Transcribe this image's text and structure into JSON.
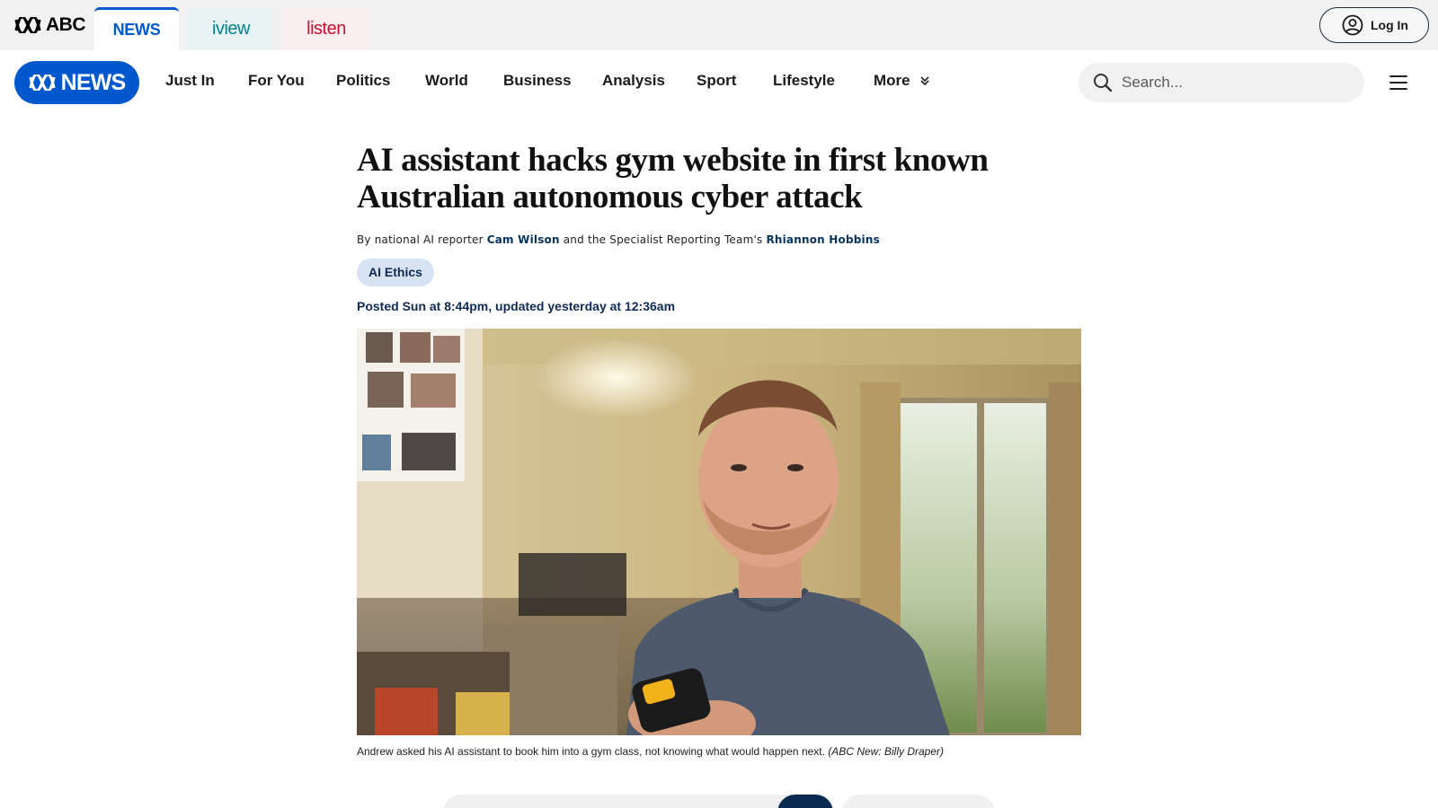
{
  "network": {
    "abc_logo_text": "ABC",
    "tabs": [
      {
        "label": "NEWS",
        "active": true
      },
      {
        "label": "iview"
      },
      {
        "label": "listen"
      }
    ],
    "login_label": "Log In"
  },
  "nav": {
    "brand_label": "NEWS",
    "items": [
      "Just In",
      "For You",
      "Politics",
      "World",
      "Business",
      "Analysis",
      "Sport",
      "Lifestyle",
      "More"
    ],
    "search_placeholder": "Search..."
  },
  "article": {
    "headline": "AI assistant hacks gym website in first known Australian autonomous cyber attack",
    "byline": {
      "prefix": "By national AI reporter",
      "author1": "Cam Wilson",
      "middle": "and the Specialist Reporting Team's",
      "author2": "Rhiannon Hobbins"
    },
    "tag": "AI Ethics",
    "timestamp": "Posted Sun at 8:44pm, updated yesterday at  12:36am",
    "caption": "Andrew asked his AI assistant to book him into a gym class, not knowing what would happen next.",
    "credit": "(ABC New: Billy Draper)"
  },
  "colors": {
    "brand_blue": "#0058cc",
    "link_navy": "#06345f",
    "tag_bg": "#d7e3f3",
    "iview_teal": "#00838f",
    "listen_red": "#c8102e"
  }
}
